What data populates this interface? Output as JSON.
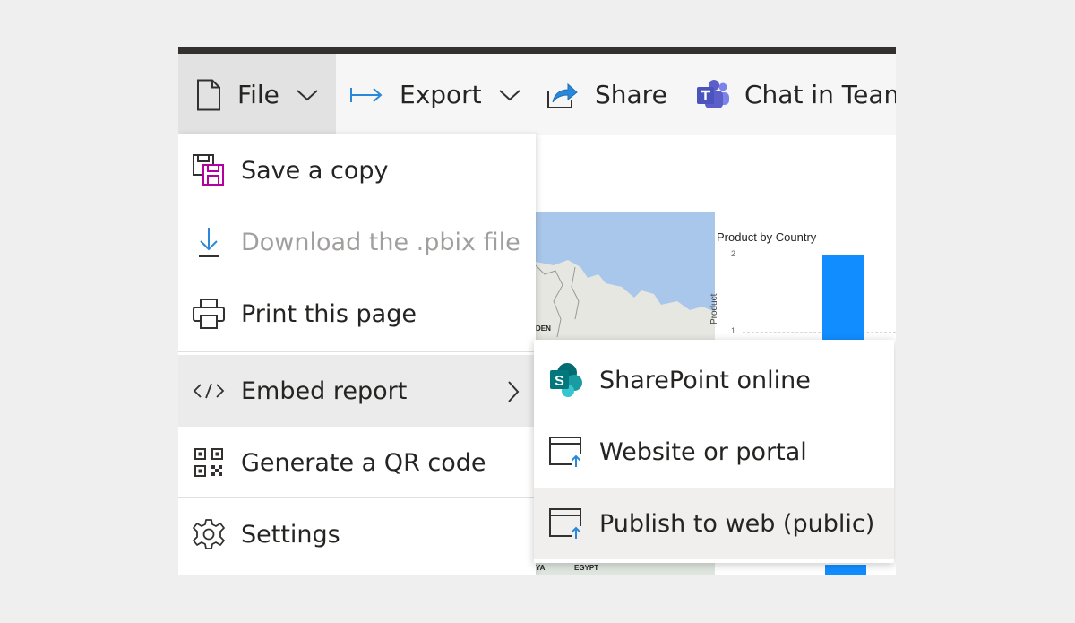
{
  "toolbar": {
    "file_label": "File",
    "export_label": "Export",
    "share_label": "Share",
    "teams_label": "Chat in Teams"
  },
  "file_menu": {
    "items": [
      {
        "label": "Save a copy",
        "icon": "save-copy-icon",
        "state": "enabled"
      },
      {
        "label": "Download the .pbix file",
        "icon": "download-icon",
        "state": "disabled"
      },
      {
        "label": "Print this page",
        "icon": "printer-icon",
        "state": "enabled"
      },
      {
        "label": "Embed report",
        "icon": "code-icon",
        "state": "active",
        "has_submenu": true
      },
      {
        "label": "Generate a QR code",
        "icon": "qr-code-icon",
        "state": "enabled"
      },
      {
        "label": "Settings",
        "icon": "gear-icon",
        "state": "enabled"
      }
    ]
  },
  "embed_submenu": {
    "items": [
      {
        "label": "SharePoint online",
        "icon": "sharepoint-icon"
      },
      {
        "label": "Website or portal",
        "icon": "website-portal-icon"
      },
      {
        "label": "Publish to web (public)",
        "icon": "publish-web-icon",
        "state": "hover"
      }
    ]
  },
  "report": {
    "chart_title": "Product by Country",
    "chart_ylabel": "Product",
    "y_ticks": [
      "2",
      "1"
    ],
    "map_labels": [
      "DEN",
      "EGYPT",
      "YA"
    ]
  },
  "colors": {
    "accent_blue": "#118dff",
    "teams_purple": "#5b5fc7",
    "sharepoint_teal": "#038387",
    "save_magenta": "#b4009e",
    "link_blue": "#2b88d8"
  }
}
